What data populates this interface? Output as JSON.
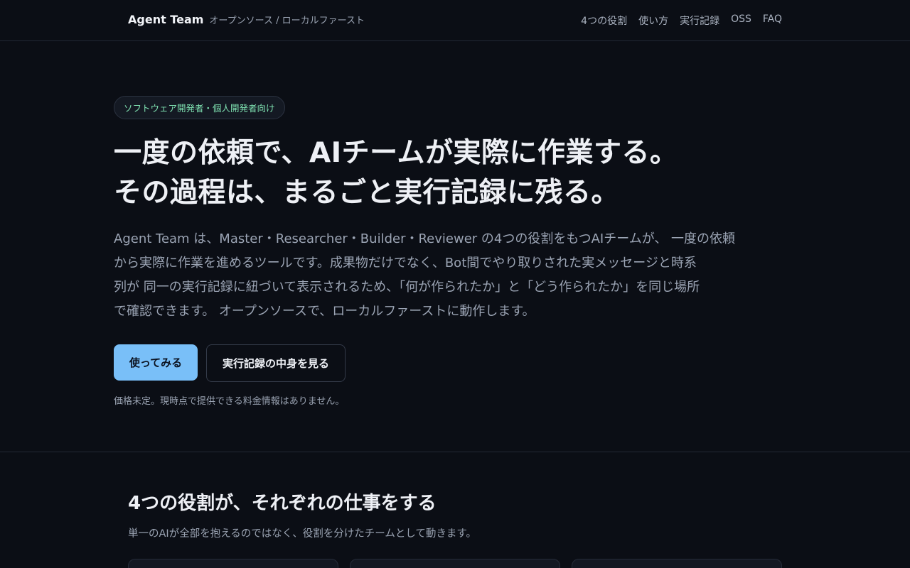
{
  "header": {
    "brand": "Agent Team",
    "tagline": "オープンソース / ローカルファースト",
    "nav": [
      "4つの役割",
      "使い方",
      "実行記録",
      "OSS",
      "FAQ"
    ]
  },
  "hero": {
    "badge": "ソフトウェア開発者・個人開発者向け",
    "title_lines": [
      "一度の依頼で、AIチームが実際に作業する。",
      "その過程は、まるごと実行記録に残る。"
    ],
    "description_lines": [
      "Agent Team は、Master・Researcher・Builder・Reviewer の4つの役割をもつAIチームが、 一度の依頼",
      "から実際に作業を進めるツールです。成果物だけでなく、Bot間でやり取りされた実メッセージと時系",
      "列が 同一の実行記録に紐づいて表示されるため、「何が作られたか」と「どう作られたか」を同じ場所",
      "で確認できます。 オープンソースで、ローカルファーストに動作します。"
    ],
    "primary_button": "使ってみる",
    "secondary_button": "実行記録の中身を見る",
    "price_note": "価格未定。現時点で提供できる料金情報はありません。"
  },
  "roles": {
    "title": "4つの役割が、それぞれの仕事をする",
    "subtitle": "単一のAIが全部を抱えるのではなく、役割を分けたチームとして動きます。"
  },
  "colors": {
    "background": "#0b0e15",
    "accent": "#79bff8",
    "badge_text": "#7ee0b0"
  }
}
